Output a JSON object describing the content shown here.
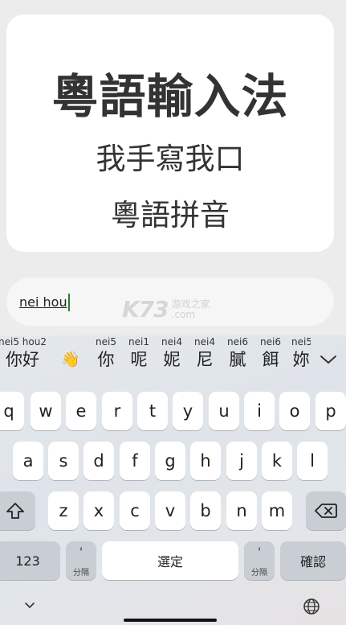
{
  "hero": {
    "title": "粵語輸入法",
    "line1": "我手寫我口",
    "line2": "粵語拼音"
  },
  "text_field": {
    "composing_text": "nei hou"
  },
  "watermark": {
    "logo": "K73",
    "site_cn": "游戏之家",
    "site_domain": ".com"
  },
  "candidates": [
    {
      "py": "nei5 hou2",
      "ch": "你好"
    },
    {
      "py": "",
      "ch": "👋"
    },
    {
      "py": "nei5",
      "ch": "你"
    },
    {
      "py": "nei1",
      "ch": "呢"
    },
    {
      "py": "nei4",
      "ch": "妮"
    },
    {
      "py": "nei4",
      "ch": "尼"
    },
    {
      "py": "nei6",
      "ch": "膩"
    },
    {
      "py": "nei6",
      "ch": "餌"
    },
    {
      "py": "nei5",
      "ch": "妳"
    }
  ],
  "keys": {
    "row1": [
      "q",
      "w",
      "e",
      "r",
      "t",
      "y",
      "u",
      "i",
      "o",
      "p"
    ],
    "row2": [
      "a",
      "s",
      "d",
      "f",
      "g",
      "h",
      "j",
      "k",
      "l"
    ],
    "row3": [
      "z",
      "x",
      "c",
      "v",
      "b",
      "n",
      "m"
    ],
    "numbers_label": "123",
    "apostrophe": "'",
    "separator_label": "分隔",
    "space_label": "選定",
    "confirm_label": "確認"
  }
}
